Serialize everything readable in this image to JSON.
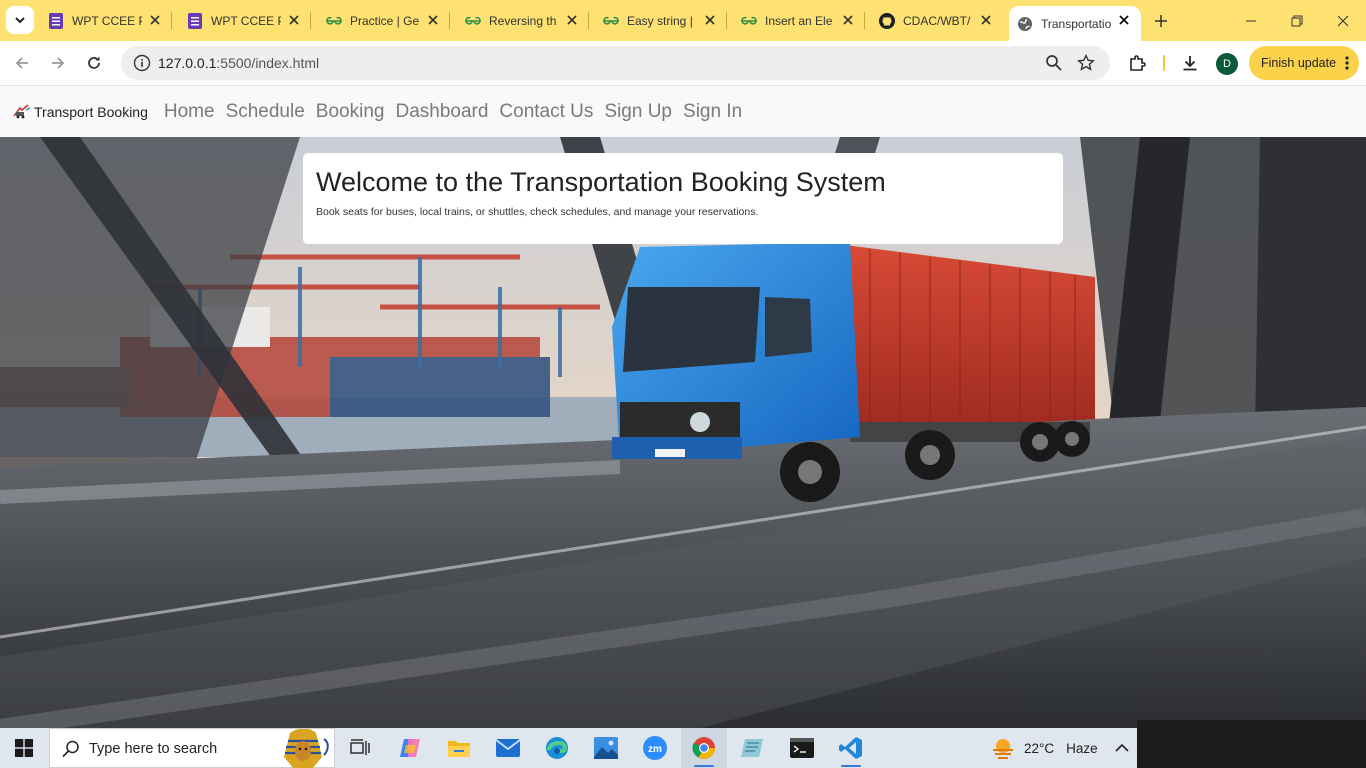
{
  "browser": {
    "tabs": [
      {
        "label": "WPT CCEE Pr",
        "icon": "forms-icon"
      },
      {
        "label": "WPT CCEE Pr",
        "icon": "forms-icon"
      },
      {
        "label": "Practice | Ge",
        "icon": "gfg-icon"
      },
      {
        "label": "Reversing th",
        "icon": "gfg-icon"
      },
      {
        "label": "Easy string |",
        "icon": "gfg-icon"
      },
      {
        "label": "Insert an Ele",
        "icon": "gfg-icon"
      },
      {
        "label": "CDAC/WBT/",
        "icon": "github-icon"
      },
      {
        "label": "Transportatio",
        "icon": "globe-icon",
        "active": true
      }
    ],
    "url_host": "127.0.0.1",
    "url_rest": ":5500/index.html",
    "profile_initial": "D",
    "finish_update": "Finish update"
  },
  "site": {
    "brand": "Transport Booking",
    "nav": [
      "Home",
      "Schedule",
      "Booking",
      "Dashboard",
      "Contact Us",
      "Sign Up",
      "Sign In"
    ],
    "hero": {
      "title": "Welcome to the Transportation Booking System",
      "subtitle": "Book seats for buses, local trains, or shuttles, check schedules, and manage your reservations."
    }
  },
  "taskbar": {
    "search_placeholder": "Type here to search",
    "temperature": "22°C",
    "condition": "Haze"
  },
  "colors": {
    "tabstrip": "#fde272",
    "accent_button": "#fbd24a",
    "truck_blue": "#1e88e5",
    "container_red": "#c63b2b"
  }
}
